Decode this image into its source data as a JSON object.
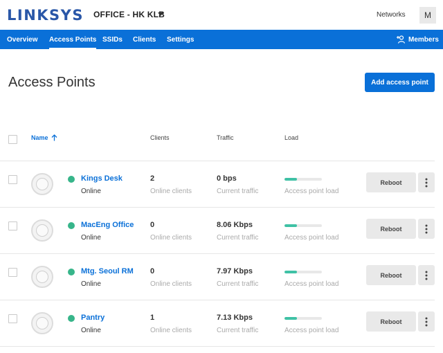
{
  "header": {
    "logo": "LINKSYS",
    "network_name": "OFFICE - HK KLB",
    "networks_link": "Networks",
    "avatar_initial": "M"
  },
  "nav": {
    "tabs": [
      {
        "label": "Overview",
        "active": false
      },
      {
        "label": "Access Points",
        "active": true
      },
      {
        "label": "SSIDs",
        "active": false
      },
      {
        "label": "Clients",
        "active": false
      },
      {
        "label": "Settings",
        "active": false
      }
    ],
    "members_label": "Members"
  },
  "page": {
    "title": "Access Points",
    "add_button": "Add access point"
  },
  "table": {
    "columns": {
      "name": "Name",
      "clients": "Clients",
      "traffic": "Traffic",
      "load": "Load"
    },
    "rows": [
      {
        "name": "Kings Desk",
        "status": "Online",
        "clients": "2",
        "clients_sub": "Online clients",
        "traffic": "0 bps",
        "traffic_sub": "Current traffic",
        "load_sub": "Access point load",
        "load_fraction": 0.33,
        "reboot": "Reboot"
      },
      {
        "name": "MacEng Office",
        "status": "Online",
        "clients": "0",
        "clients_sub": "Online clients",
        "traffic": "8.06 Kbps",
        "traffic_sub": "Current traffic",
        "load_sub": "Access point load",
        "load_fraction": 0.33,
        "reboot": "Reboot"
      },
      {
        "name": "Mtg. Seoul RM",
        "status": "Online",
        "clients": "0",
        "clients_sub": "Online clients",
        "traffic": "7.97 Kbps",
        "traffic_sub": "Current traffic",
        "load_sub": "Access point load",
        "load_fraction": 0.33,
        "reboot": "Reboot"
      },
      {
        "name": "Pantry",
        "status": "Online",
        "clients": "1",
        "clients_sub": "Online clients",
        "traffic": "7.13 Kbps",
        "traffic_sub": "Current traffic",
        "load_sub": "Access point load",
        "load_fraction": 0.33,
        "reboot": "Reboot"
      }
    ]
  },
  "colors": {
    "brand": "#2a57a8",
    "primary": "#0a70d8",
    "online": "#37b58a",
    "load": "#3fc1a5"
  }
}
